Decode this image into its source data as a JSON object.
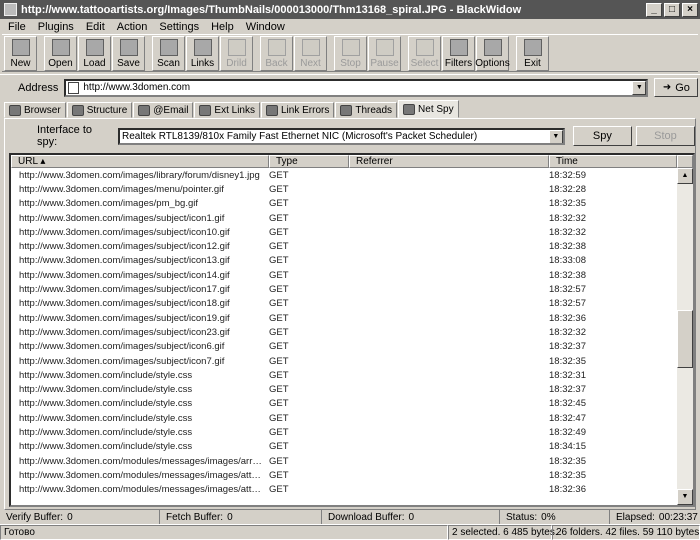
{
  "window": {
    "title": "http://www.tattooartists.org/Images/ThumbNails/000013000/Thm13168_spiral.JPG - BlackWidow"
  },
  "menu": [
    "File",
    "Plugins",
    "Edit",
    "Action",
    "Settings",
    "Help",
    "Window"
  ],
  "toolbar": [
    {
      "label": "New",
      "icon": "new-page-icon",
      "enabled": true
    },
    {
      "label": "Open",
      "icon": "open-folder-icon",
      "enabled": true
    },
    {
      "label": "Load",
      "icon": "load-icon",
      "enabled": true
    },
    {
      "label": "Save",
      "icon": "floppy-disk-icon",
      "enabled": true
    },
    {
      "label": "Scan",
      "icon": "scan-magnifier-icon",
      "enabled": true
    },
    {
      "label": "Links",
      "icon": "links-icon",
      "enabled": true
    },
    {
      "label": "Drild",
      "icon": "drill-icon",
      "enabled": false
    },
    {
      "label": "Back",
      "icon": "back-arrow-icon",
      "enabled": false
    },
    {
      "label": "Next",
      "icon": "next-arrow-icon",
      "enabled": false
    },
    {
      "label": "Stop",
      "icon": "stop-icon",
      "enabled": false
    },
    {
      "label": "Pause",
      "icon": "pause-icon",
      "enabled": false
    },
    {
      "label": "Select",
      "icon": "select-icon",
      "enabled": false
    },
    {
      "label": "Filters",
      "icon": "filter-icon",
      "enabled": true
    },
    {
      "label": "Options",
      "icon": "options-icon",
      "enabled": true
    },
    {
      "label": "Exit",
      "icon": "close-x-icon",
      "enabled": true
    }
  ],
  "address": {
    "label": "Address",
    "value": "http://www.3domen.com",
    "go_label": "Go"
  },
  "tabs": [
    {
      "label": "Browser",
      "active": false
    },
    {
      "label": "Structure",
      "active": false
    },
    {
      "label": "@Email",
      "active": false
    },
    {
      "label": "Ext Links",
      "active": false
    },
    {
      "label": "Link Errors",
      "active": false
    },
    {
      "label": "Threads",
      "active": false
    },
    {
      "label": "Net Spy",
      "active": true
    }
  ],
  "spy": {
    "interface_label": "Interface to spy:",
    "interface_value": "Realtek RTL8139/810x Family Fast Ethernet NIC (Microsoft's Packet Scheduler)",
    "spy_label": "Spy",
    "stop_label": "Stop"
  },
  "columns": {
    "url": "URL",
    "type": "Type",
    "referrer": "Referrer",
    "time": "Time"
  },
  "rows": [
    {
      "url": "http://www.3domen.com/images/library/forum/disney1.jpg",
      "type": "GET",
      "referrer": "",
      "time": "18:32:59"
    },
    {
      "url": "http://www.3domen.com/images/menu/pointer.gif",
      "type": "GET",
      "referrer": "",
      "time": "18:32:28"
    },
    {
      "url": "http://www.3domen.com/images/pm_bg.gif",
      "type": "GET",
      "referrer": "",
      "time": "18:32:35"
    },
    {
      "url": "http://www.3domen.com/images/subject/icon1.gif",
      "type": "GET",
      "referrer": "",
      "time": "18:32:32"
    },
    {
      "url": "http://www.3domen.com/images/subject/icon10.gif",
      "type": "GET",
      "referrer": "",
      "time": "18:32:32"
    },
    {
      "url": "http://www.3domen.com/images/subject/icon12.gif",
      "type": "GET",
      "referrer": "",
      "time": "18:32:38"
    },
    {
      "url": "http://www.3domen.com/images/subject/icon13.gif",
      "type": "GET",
      "referrer": "",
      "time": "18:33:08"
    },
    {
      "url": "http://www.3domen.com/images/subject/icon14.gif",
      "type": "GET",
      "referrer": "",
      "time": "18:32:38"
    },
    {
      "url": "http://www.3domen.com/images/subject/icon17.gif",
      "type": "GET",
      "referrer": "",
      "time": "18:32:57"
    },
    {
      "url": "http://www.3domen.com/images/subject/icon18.gif",
      "type": "GET",
      "referrer": "",
      "time": "18:32:57"
    },
    {
      "url": "http://www.3domen.com/images/subject/icon19.gif",
      "type": "GET",
      "referrer": "",
      "time": "18:32:36"
    },
    {
      "url": "http://www.3domen.com/images/subject/icon23.gif",
      "type": "GET",
      "referrer": "",
      "time": "18:32:32"
    },
    {
      "url": "http://www.3domen.com/images/subject/icon6.gif",
      "type": "GET",
      "referrer": "",
      "time": "18:32:37"
    },
    {
      "url": "http://www.3domen.com/images/subject/icon7.gif",
      "type": "GET",
      "referrer": "",
      "time": "18:32:35"
    },
    {
      "url": "http://www.3domen.com/include/style.css",
      "type": "GET",
      "referrer": "",
      "time": "18:32:31"
    },
    {
      "url": "http://www.3domen.com/include/style.css",
      "type": "GET",
      "referrer": "",
      "time": "18:32:37"
    },
    {
      "url": "http://www.3domen.com/include/style.css",
      "type": "GET",
      "referrer": "",
      "time": "18:32:45"
    },
    {
      "url": "http://www.3domen.com/include/style.css",
      "type": "GET",
      "referrer": "",
      "time": "18:32:47"
    },
    {
      "url": "http://www.3domen.com/include/style.css",
      "type": "GET",
      "referrer": "",
      "time": "18:32:49"
    },
    {
      "url": "http://www.3domen.com/include/style.css",
      "type": "GET",
      "referrer": "",
      "time": "18:34:15"
    },
    {
      "url": "http://www.3domen.com/modules/messages/images/arrow.gif",
      "type": "GET",
      "referrer": "",
      "time": "18:32:35"
    },
    {
      "url": "http://www.3domen.com/modules/messages/images/attachme...",
      "type": "GET",
      "referrer": "",
      "time": "18:32:35"
    },
    {
      "url": "http://www.3domen.com/modules/messages/images/attachme...",
      "type": "GET",
      "referrer": "",
      "time": "18:32:36"
    }
  ],
  "buffers": {
    "verify_label": "Verify Buffer:",
    "verify_value": "0",
    "fetch_label": "Fetch Buffer:",
    "fetch_value": "0",
    "download_label": "Download Buffer:",
    "download_value": "0",
    "status_label": "Status:",
    "status_value": "0%",
    "elapsed_label": "Elapsed:",
    "elapsed_value": "00:23:37"
  },
  "status": {
    "ready": "Готово",
    "selected": "2 selected. 6 485 bytes.",
    "totals": "26 folders. 42 files. 59 110 bytes."
  }
}
